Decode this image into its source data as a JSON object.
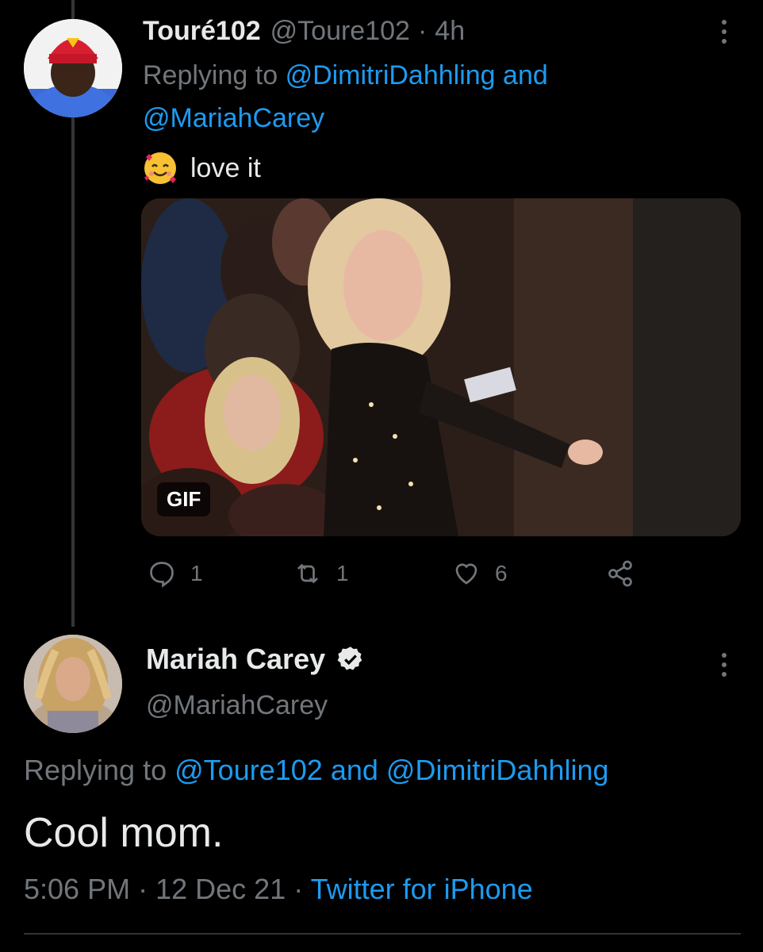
{
  "tweet1": {
    "display_name": "Touré102",
    "handle": "@Toure102",
    "separator": "·",
    "time_ago": "4h",
    "replying_prefix": "Replying to",
    "replying_to_1": "@DimitriDahhling",
    "replying_and": "and",
    "replying_to_2": "@MariahCarey",
    "emoji": "smiling-face-with-hearts",
    "text": "love it",
    "media_badge": "GIF",
    "reply_count": "1",
    "retweet_count": "1",
    "like_count": "6"
  },
  "tweet2": {
    "display_name": "Mariah Carey",
    "handle": "@MariahCarey",
    "replying_prefix": "Replying to",
    "replying_to_1": "@Toure102",
    "replying_and": "and",
    "replying_to_2": "@DimitriDahhling",
    "text": "Cool mom.",
    "time": "5:06 PM",
    "separator": "·",
    "date": "12 Dec 21",
    "separator2": "·",
    "source": "Twitter for iPhone"
  },
  "colors": {
    "background": "#000000",
    "text": "#e7e9ea",
    "muted": "#71767b",
    "link": "#1d9bf0"
  }
}
